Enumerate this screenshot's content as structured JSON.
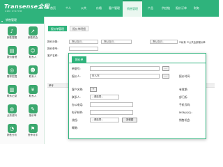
{
  "header": {
    "logo": "Transense全程",
    "logo_sub": "CRM SYSTEM",
    "nav": [
      "首页",
      "个人",
      "公共",
      "价格",
      "客户管理",
      "销售管理",
      "产品",
      "供应链",
      "报价订单",
      "财务"
    ],
    "active_nav_index": 5
  },
  "sidebar": {
    "title": "销售管理",
    "tiles": [
      {
        "label": "销售提醒",
        "icon": "bell-icon",
        "color": "#3aa76d"
      },
      {
        "label": "销售机会",
        "icon": "chart-icon",
        "color": "#3aa76d"
      },
      {
        "label": "报价管理",
        "icon": "document-icon",
        "color": "#3aa76d"
      },
      {
        "label": "联系人",
        "icon": "contact-icon",
        "color": "#3aa76d"
      },
      {
        "label": "需求挖掘",
        "icon": "target-icon",
        "color": "#3aa76d"
      },
      {
        "label": "联系人",
        "icon": "person-icon",
        "color": "#3aa76d"
      },
      {
        "label": "联系记录",
        "icon": "book-icon",
        "color": "#3aa76d"
      },
      {
        "label": "联系人",
        "icon": "coin-icon",
        "color": "#3aa76d"
      },
      {
        "label": "业务资料",
        "icon": "globe-icon",
        "color": "#3aa76d"
      },
      {
        "label": "报价单",
        "icon": "edit-icon",
        "color": "#3aa76d"
      },
      {
        "label": "销售分析",
        "icon": "pie-icon",
        "color": "#3aa76d"
      },
      {
        "label": "竞争对手",
        "icon": "rival-icon",
        "color": "#3aa76d"
      }
    ]
  },
  "main": {
    "tabs": [
      "报价单管理",
      "报价单明细"
    ],
    "row1_label": "报价对象:",
    "row1_sel1": "--默认自己--",
    "row1_sel2": "--默认自己--",
    "row1_sel3": "--默认自己--",
    "row1_chk": "☑私有 ☑公共全部报价单",
    "row2_label": "报价单号:",
    "row3_label": "客户名称:",
    "list_header": "单号"
  },
  "dialog": {
    "tab": "报价单",
    "fields": {
      "quote_no_label": "单据号:",
      "quote_person_label": "报价人:",
      "quote_person_value": "年人东",
      "customer_label": "客户名称:",
      "contact_label": "联系人:",
      "contact_value": "--请选择--",
      "phone_label": "办公电话:",
      "email_label": "电子邮件:",
      "flow_label": "流程:",
      "flow_value": "--请选择--",
      "flow_button": "流程图",
      "remark_label": "概略:",
      "right_date_label": "报价时间:",
      "right_validity_label": "有效期:",
      "right_dept_label": "部门所:",
      "right_mobile_label": "手机号码:",
      "right_msn_label": "MSN(QQ):",
      "right_sales_label": "销售机会:"
    },
    "browse_button": "..."
  }
}
